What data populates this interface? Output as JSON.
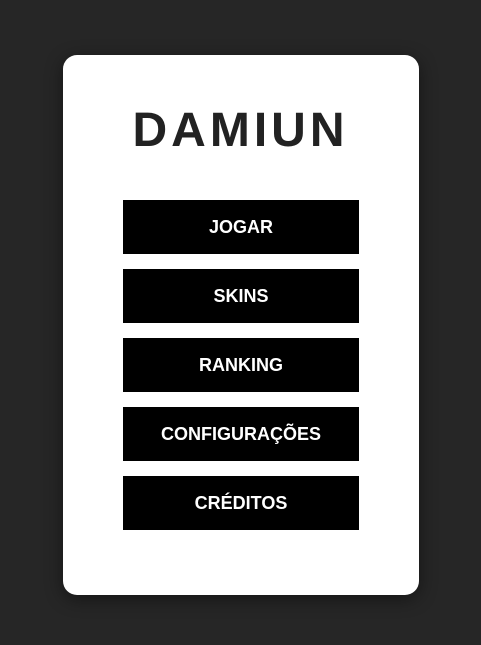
{
  "title": "DAMIUN",
  "menu": {
    "items": [
      {
        "label": "JOGAR"
      },
      {
        "label": "SKINS"
      },
      {
        "label": "RANKING"
      },
      {
        "label": "CONFIGURAÇÕES"
      },
      {
        "label": "CRÉDITOS"
      }
    ]
  },
  "colors": {
    "background": "#262626",
    "card": "#ffffff",
    "title": "#222222",
    "button_bg": "#000000",
    "button_text": "#ffffff"
  }
}
